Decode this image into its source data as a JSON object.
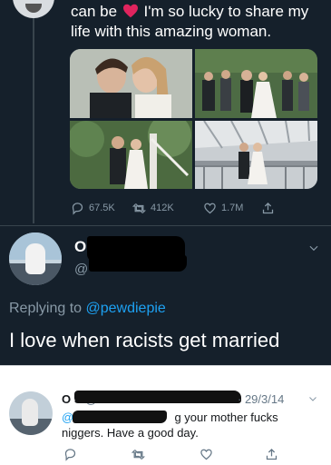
{
  "tweet": {
    "text_part1": "can be",
    "text_part2": "I'm so lucky to share my",
    "text_line2": "life with this amazing woman.",
    "emoji": "heart-emoji",
    "stats": {
      "replies": "67.5K",
      "retweets": "412K",
      "likes": "1.7M"
    }
  },
  "reply": {
    "name_visible": "O    n S",
    "handle_visible": "@",
    "replying_prefix": "Replying to",
    "replying_handle": "@pewdiepie",
    "body": "I love when racists get married"
  },
  "old_reply": {
    "name_visible": "O    S",
    "handle_visible": "@",
    "date": "29/3/14",
    "handle_fragment": "@",
    "text_part1": "g your mother fucks",
    "text_line2": "niggers. Have a good day."
  },
  "colors": {
    "dark_bg": "#15202b",
    "muted": "#8899a6",
    "link": "#1da1f2",
    "heart": "#e0245e"
  }
}
